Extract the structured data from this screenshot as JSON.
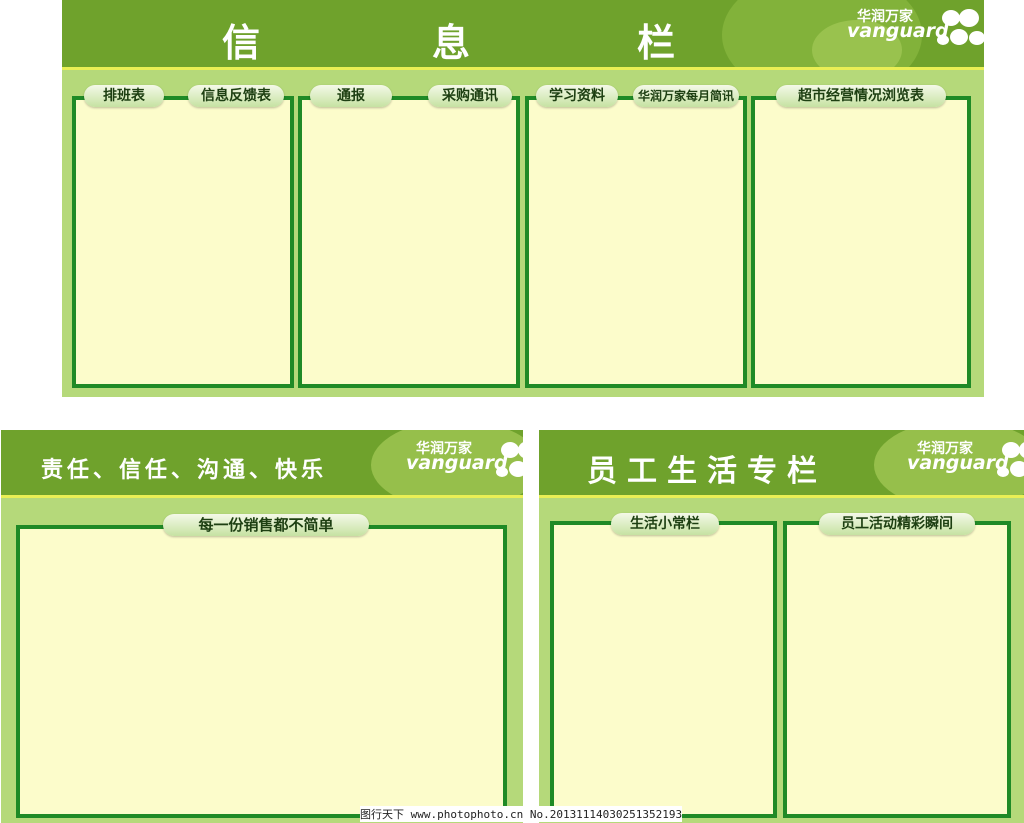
{
  "top_board": {
    "title_chars": [
      "信",
      "息",
      "栏"
    ],
    "tabs": [
      "排班表",
      "信息反馈表",
      "通报",
      "采购通讯",
      "学习资料",
      "华润万家每月简讯",
      "超市经营情况浏览表"
    ]
  },
  "left_board": {
    "title": "责任、信任、沟通、快乐",
    "tabs": [
      "每一份销售都不简单"
    ]
  },
  "right_board": {
    "title": "员工生活专栏",
    "tabs": [
      "生活小常栏",
      "员工活动精彩瞬间"
    ]
  },
  "logo": {
    "cn": "华润万家",
    "en": "vanguard"
  },
  "watermark": "图行天下 www.photophoto.cn No.20131114030251352193",
  "colors": {
    "header": "#6fa22c",
    "board": "#b5d97a",
    "panel": "#fcfccb",
    "border": "#1f8a26"
  }
}
